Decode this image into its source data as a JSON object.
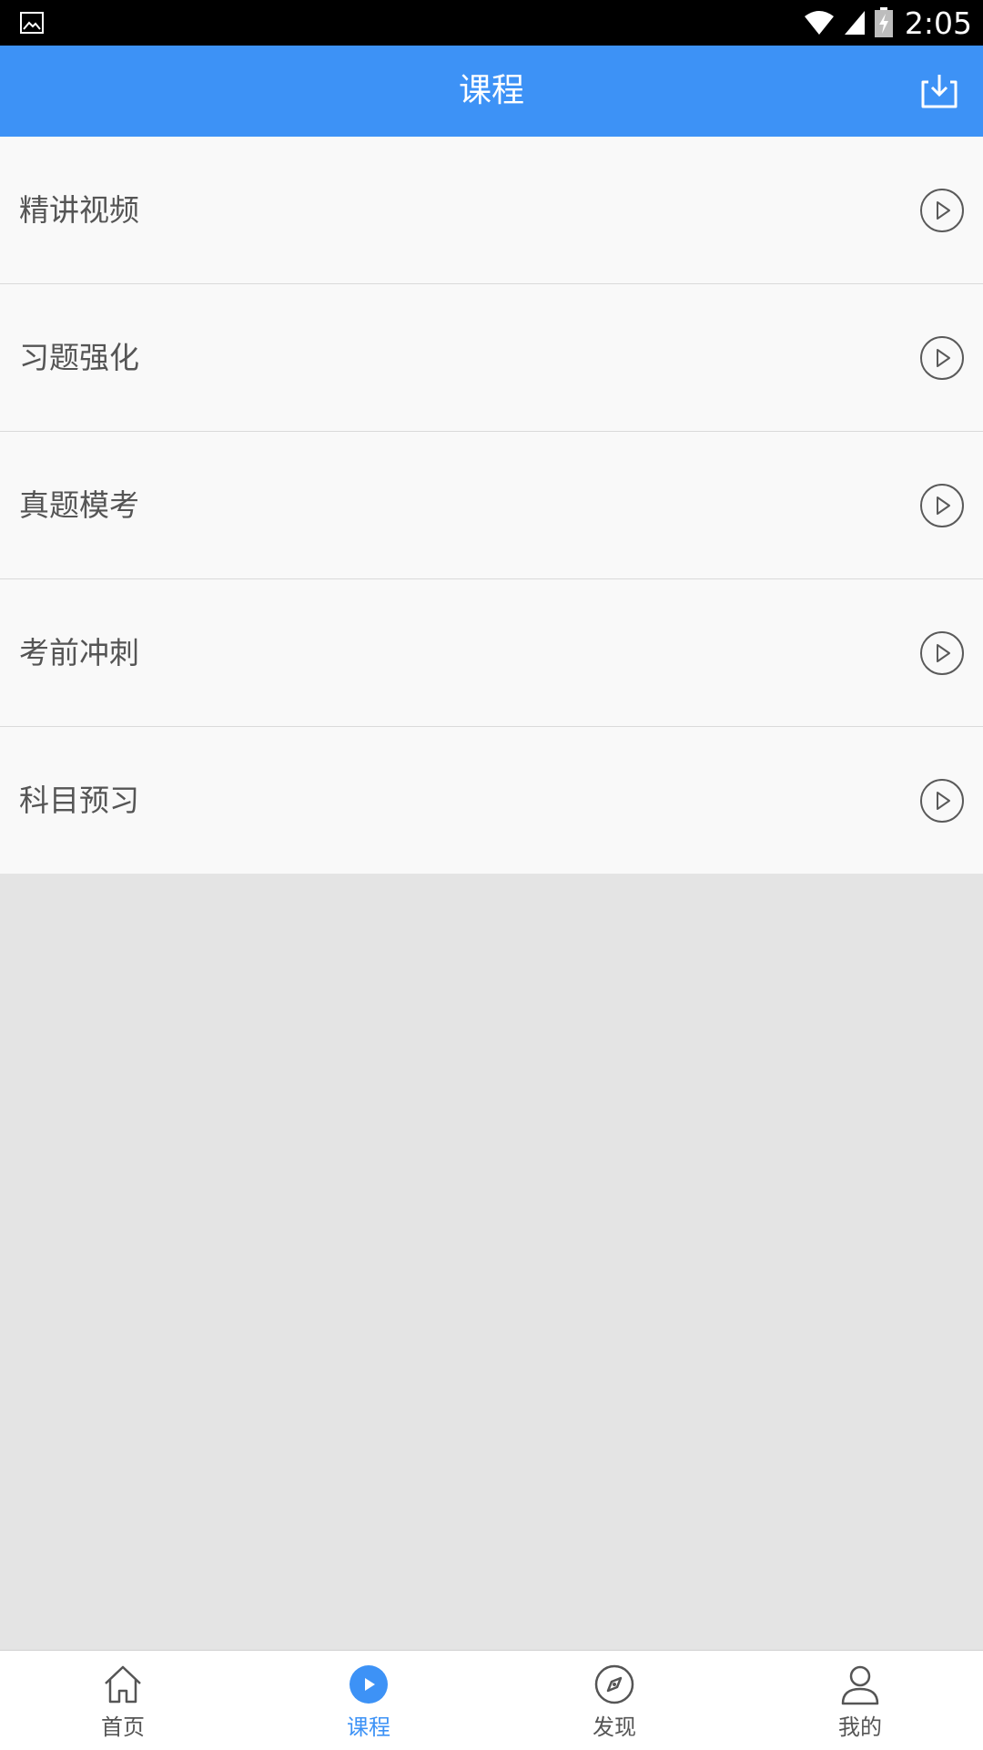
{
  "status_bar": {
    "time": "2:05",
    "icons": [
      "image-icon",
      "wifi-icon",
      "signal-icon",
      "battery-charging-icon"
    ]
  },
  "app_bar": {
    "title": "课程",
    "action_icon": "download-icon"
  },
  "course_list": {
    "items": [
      {
        "label": "精讲视频",
        "icon": "play-circle-icon"
      },
      {
        "label": "习题强化",
        "icon": "play-circle-icon"
      },
      {
        "label": "真题模考",
        "icon": "play-circle-icon"
      },
      {
        "label": "考前冲刺",
        "icon": "play-circle-icon"
      },
      {
        "label": "科目预习",
        "icon": "play-circle-icon"
      }
    ]
  },
  "tab_bar": {
    "tabs": [
      {
        "label": "首页",
        "icon": "home-icon",
        "active": false
      },
      {
        "label": "课程",
        "icon": "play-filled-circle-icon",
        "active": true
      },
      {
        "label": "发现",
        "icon": "compass-icon",
        "active": false
      },
      {
        "label": "我的",
        "icon": "person-icon",
        "active": false
      }
    ]
  },
  "colors": {
    "primary": "#3d92f6",
    "list_background": "#f9f9f9",
    "page_background": "#e4e4e4",
    "text": "#555555"
  }
}
